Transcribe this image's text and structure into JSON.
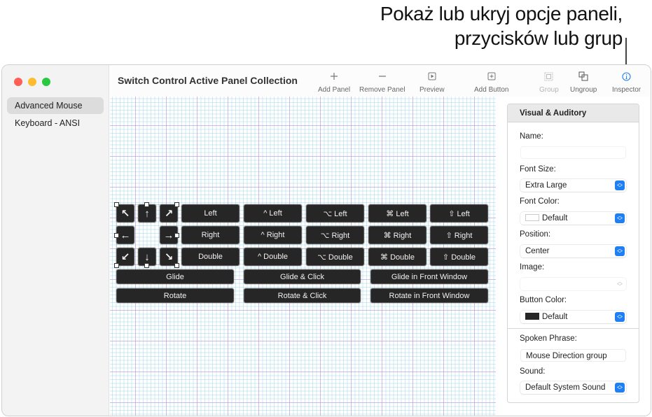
{
  "callout": {
    "line1": "Pokaż lub ukryj opcje paneli,",
    "line2": "przycisków lub grup"
  },
  "window": {
    "title": "Switch Control Active Panel Collection",
    "traffic_colors": {
      "close": "#ff5f57",
      "minimize": "#febc2e",
      "zoom": "#28c840"
    }
  },
  "sidebar": {
    "items": [
      {
        "label": "Advanced Mouse",
        "selected": true
      },
      {
        "label": "Keyboard - ANSI",
        "selected": false
      }
    ]
  },
  "toolbar": {
    "buttons": [
      {
        "label": "Add Panel",
        "icon": "plus-icon",
        "enabled": true
      },
      {
        "label": "Remove Panel",
        "icon": "minus-icon",
        "enabled": true
      },
      {
        "label": "Preview",
        "icon": "play-square-icon",
        "enabled": true
      },
      {
        "label": "Add Button",
        "icon": "plus-square-icon",
        "enabled": true
      },
      {
        "label": "Group",
        "icon": "group-icon",
        "enabled": false
      },
      {
        "label": "Ungroup",
        "icon": "ungroup-icon",
        "enabled": true
      },
      {
        "label": "Inspector",
        "icon": "info-circle-icon",
        "enabled": true,
        "active": true
      }
    ],
    "accent_color": "#1f7ff5"
  },
  "panel": {
    "arrows": {
      "up_left": "↖",
      "up": "↑",
      "up_right": "↗",
      "left": "←",
      "right": "→",
      "down_left": "↙",
      "down": "↓",
      "down_right": "↘"
    },
    "rows": [
      [
        "Left",
        "^ Left",
        "⌥ Left",
        "⌘ Left",
        "⇧ Left"
      ],
      [
        "Right",
        "^ Right",
        "⌥ Right",
        "⌘ Right",
        "⇧ Right"
      ],
      [
        "Double",
        "^ Double",
        "⌥ Double",
        "⌘ Double",
        "⇧ Double"
      ]
    ],
    "wide_rows": [
      [
        "Glide",
        "Glide & Click",
        "Glide in Front Window"
      ],
      [
        "Rotate",
        "Rotate & Click",
        "Rotate in Front Window"
      ]
    ]
  },
  "inspector": {
    "section_title": "Visual & Auditory",
    "name_label": "Name:",
    "name_value": "",
    "font_size_label": "Font Size:",
    "font_size_value": "Extra Large",
    "font_color_label": "Font Color:",
    "font_color_value": "Default",
    "font_color_swatch": "#ffffff",
    "position_label": "Position:",
    "position_value": "Center",
    "image_label": "Image:",
    "image_value": "",
    "button_color_label": "Button Color:",
    "button_color_value": "Default",
    "button_color_swatch": "#262626",
    "spoken_phrase_label": "Spoken Phrase:",
    "spoken_phrase_value": "Mouse Direction group",
    "sound_label": "Sound:",
    "sound_value": "Default System Sound"
  }
}
